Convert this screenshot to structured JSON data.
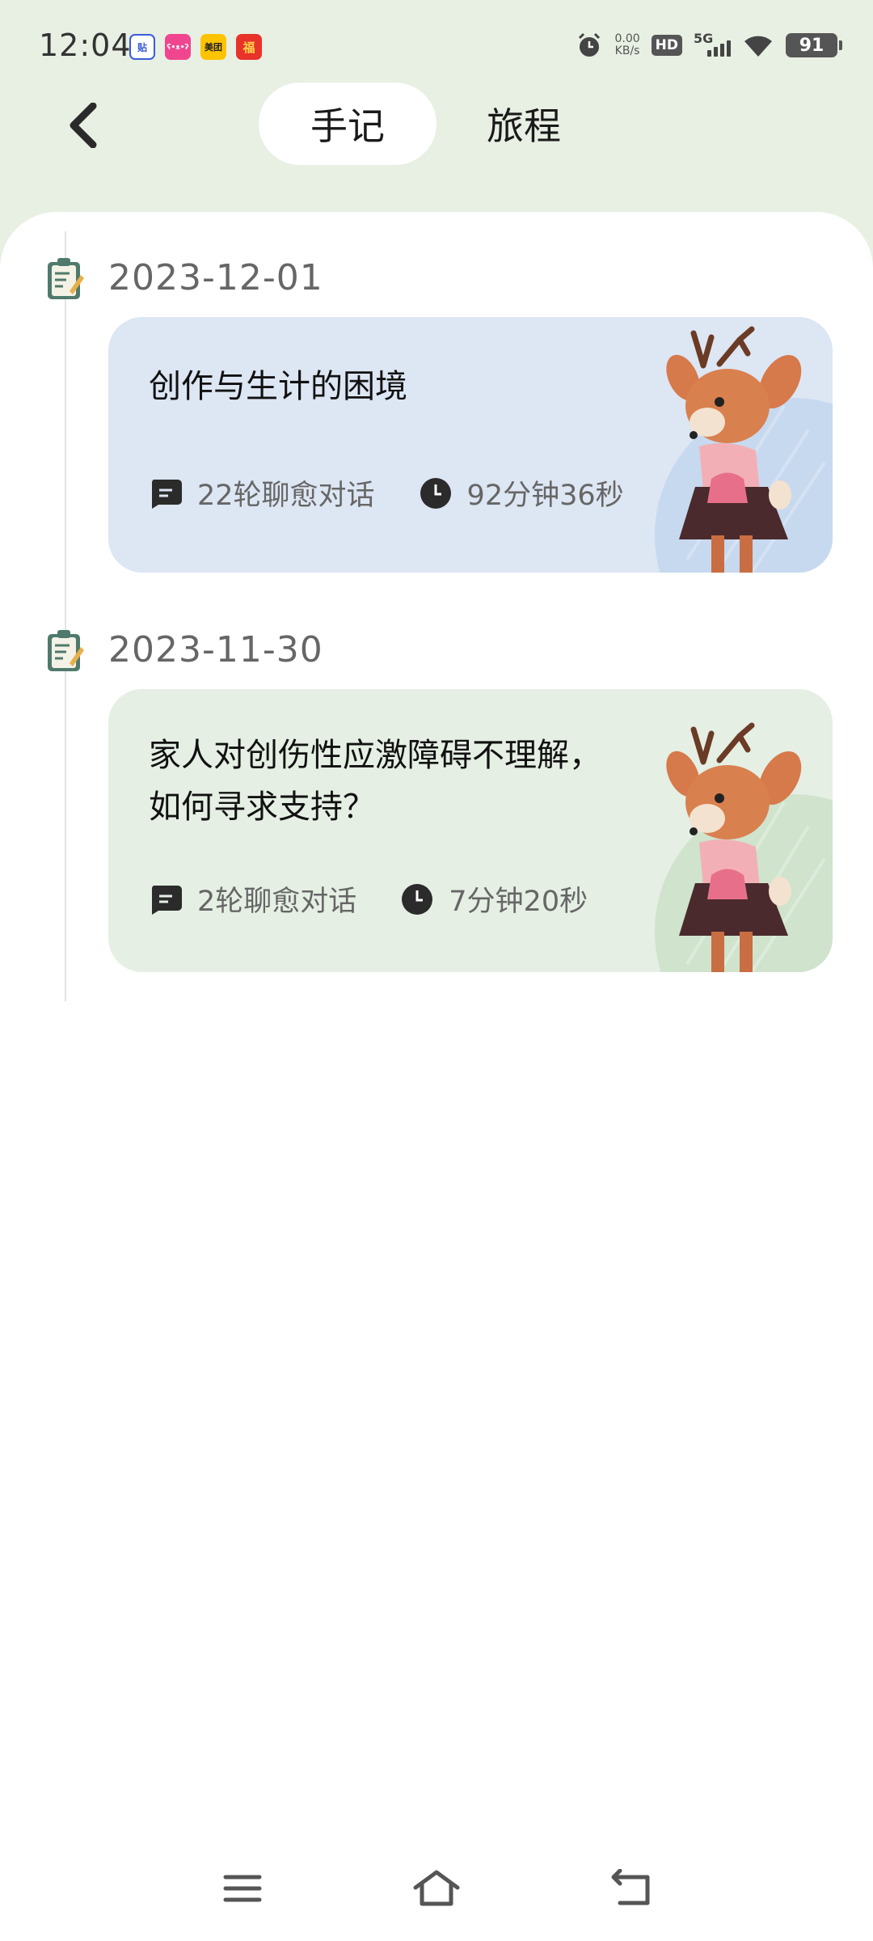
{
  "status_bar": {
    "time": "12:04",
    "app_badges": [
      {
        "icon": "tieba-app-icon",
        "text": "贴",
        "color": "#3d5bd8"
      },
      {
        "icon": "app-icon-pink",
        "text": "ʕ•ᴥ•ʔ",
        "color": "#f0458f"
      },
      {
        "icon": "meituan-app-icon",
        "text": "美团",
        "color": "#ffc300"
      },
      {
        "icon": "app-icon-red",
        "text": "福",
        "color": "#e8332a"
      }
    ],
    "net_speed_value": "0.00",
    "net_speed_unit": "KB/s",
    "hd_label": "HD",
    "network_label": "5G",
    "battery": "91"
  },
  "header": {
    "tabs": [
      {
        "label": "手记",
        "active": true
      },
      {
        "label": "旅程",
        "active": false
      }
    ]
  },
  "entries": [
    {
      "date": "2023-12-01",
      "title": "创作与生计的困境",
      "rounds": "22轮聊愈对话",
      "duration": "92分钟36秒",
      "theme_color": "#dde6f3"
    },
    {
      "date": "2023-11-30",
      "title": "家人对创伤性应激障碍不理解，如何寻求支持？",
      "rounds": "2轮聊愈对话",
      "duration": "7分钟20秒",
      "theme_color": "#e5efe4"
    }
  ],
  "colors": {
    "header_bg": "#e8efe3",
    "sheet_bg": "#ffffff",
    "card_blue": "#dde6f3",
    "card_green": "#e5efe4"
  }
}
